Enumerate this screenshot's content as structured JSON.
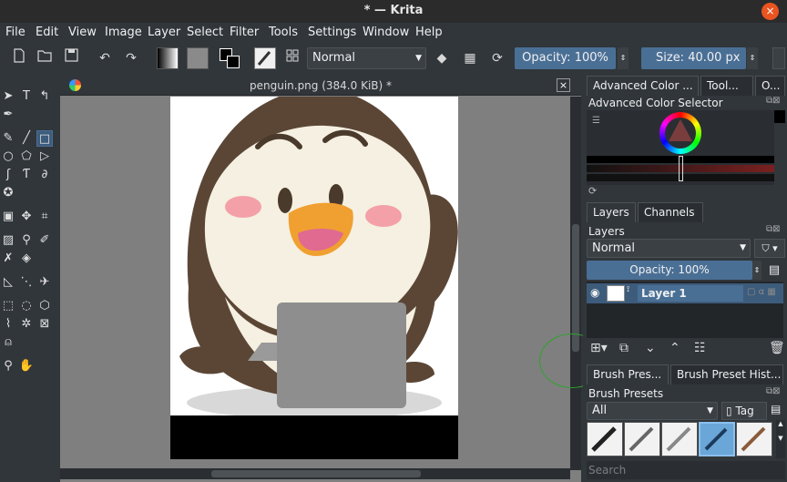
{
  "window": {
    "title": "* — Krita",
    "close_glyph": "×"
  },
  "menu": [
    "File",
    "Edit",
    "View",
    "Image",
    "Layer",
    "Select",
    "Filter",
    "Tools",
    "Settings",
    "Window",
    "Help"
  ],
  "toolbar": {
    "blend_mode": "Normal",
    "opacity_label": "Opacity: 100%",
    "size_label": "Size: 40.00 px"
  },
  "document": {
    "tab_title": "penguin.png (384.0 KiB) *",
    "close_glyph": "×"
  },
  "docker_top": {
    "tabs": [
      "Advanced Color ...",
      "Tool...",
      "O..."
    ],
    "panel_title": "Advanced Color Selector"
  },
  "layers": {
    "tabs": [
      "Layers",
      "Channels"
    ],
    "panel_title": "Layers",
    "blend_mode": "Normal",
    "opacity_label": "Opacity:  100%",
    "layer_name": "Layer 1"
  },
  "brush": {
    "tabs": [
      "Brush Pres...",
      "Brush Preset Hist..."
    ],
    "panel_title": "Brush Presets",
    "filter_value": "All",
    "tag_label": "Tag",
    "search_placeholder": "Search"
  },
  "colors": {
    "accent": "#4a6f95",
    "background": "#31363b",
    "canvas_bg": "#7f7f7f",
    "penguin_brown": "#5b4636",
    "penguin_cream": "#f5f0e1",
    "beak": "#f0a030",
    "cheek": "#f4a0a8"
  }
}
